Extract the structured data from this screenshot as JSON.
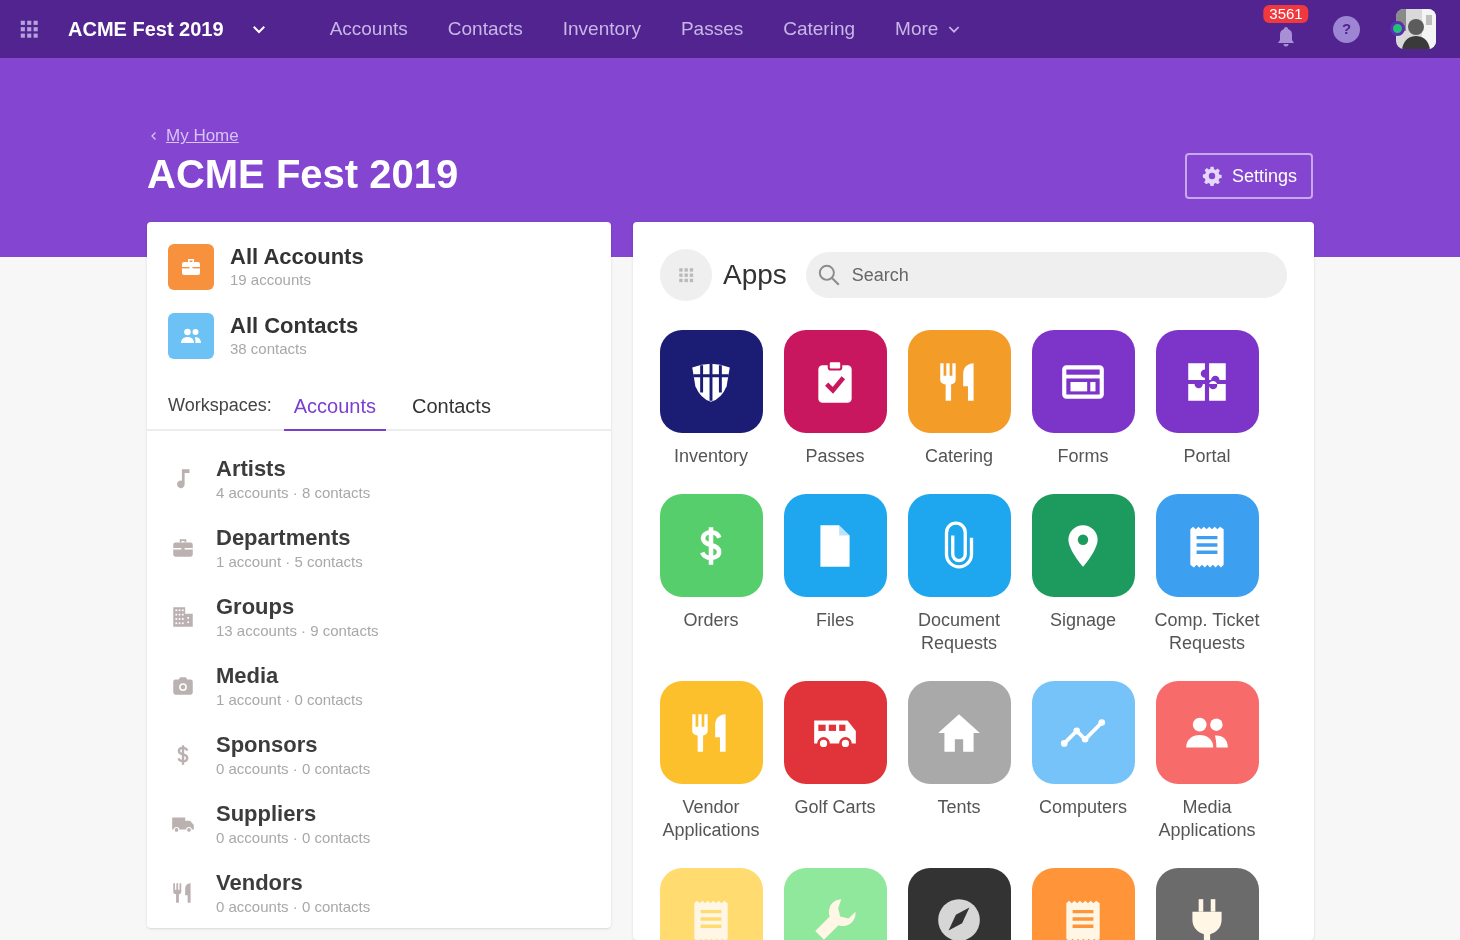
{
  "topbar": {
    "title": "ACME Fest 2019",
    "nav": [
      "Accounts",
      "Contacts",
      "Inventory",
      "Passes",
      "Catering"
    ],
    "more": "More",
    "notifications": "3561",
    "help": "?"
  },
  "header": {
    "breadcrumb": "My Home",
    "title": "ACME Fest 2019",
    "settings": "Settings"
  },
  "summary": [
    {
      "title": "All Accounts",
      "subtitle": "19 accounts",
      "color": "#f7913d"
    },
    {
      "title": "All Contacts",
      "subtitle": "38 contacts",
      "color": "#6cc1f5"
    }
  ],
  "workspaces": {
    "label": "Workspaces:",
    "tabs": [
      {
        "label": "Accounts",
        "selected": true
      },
      {
        "label": "Contacts",
        "selected": false
      }
    ],
    "items": [
      {
        "title": "Artists",
        "subtitle": "4 accounts · 8 contacts"
      },
      {
        "title": "Departments",
        "subtitle": "1 account · 5 contacts"
      },
      {
        "title": "Groups",
        "subtitle": "13 accounts · 9 contacts"
      },
      {
        "title": "Media",
        "subtitle": "1 account · 0 contacts"
      },
      {
        "title": "Sponsors",
        "subtitle": "0 accounts · 0 contacts"
      },
      {
        "title": "Suppliers",
        "subtitle": "0 accounts · 0 contacts"
      },
      {
        "title": "Vendors",
        "subtitle": "0 accounts · 0 contacts"
      }
    ]
  },
  "apps": {
    "title": "Apps",
    "search": {
      "placeholder": "Search"
    },
    "items": [
      {
        "label": "Inventory",
        "color": "#1b1c74"
      },
      {
        "label": "Passes",
        "color": "#c8175f"
      },
      {
        "label": "Catering",
        "color": "#f39c28"
      },
      {
        "label": "Forms",
        "color": "#7d35c9"
      },
      {
        "label": "Portal",
        "color": "#7d35c9"
      },
      {
        "label": "Orders",
        "color": "#56ce6b"
      },
      {
        "label": "Files",
        "color": "#1ea7ee"
      },
      {
        "label": "Document Requests",
        "color": "#1ea7ee"
      },
      {
        "label": "Signage",
        "color": "#1d9a5e"
      },
      {
        "label": "Comp. Ticket Requests",
        "color": "#3d9ff0"
      },
      {
        "label": "Vendor Applications",
        "color": "#fcc02d"
      },
      {
        "label": "Golf Carts",
        "color": "#e0333a"
      },
      {
        "label": "Tents",
        "color": "#a9a9a9"
      },
      {
        "label": "Computers",
        "color": "#75c3f8"
      },
      {
        "label": "Media Applications",
        "color": "#f76b6b"
      },
      {
        "color": "#ffdb70"
      },
      {
        "color": "#90e89c"
      },
      {
        "color": "#333333"
      },
      {
        "color": "#ff9538"
      },
      {
        "color": "#6b6b6b"
      }
    ]
  }
}
